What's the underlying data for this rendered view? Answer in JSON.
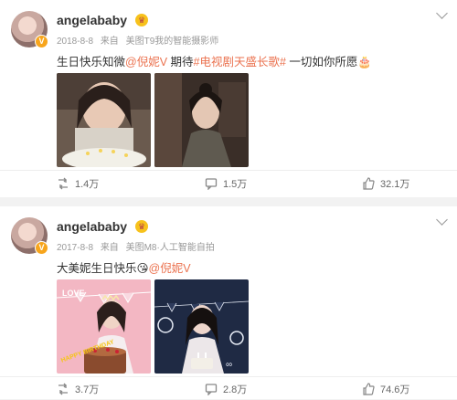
{
  "posts": [
    {
      "username": "angelababy",
      "date": "2018-8-8",
      "from_label": "来自",
      "source": "美图T9我的智能摄影师",
      "text_prefix": "生日快乐知微",
      "mention": "@倪妮V",
      "text_mid": " 期待",
      "topic": "#电视剧天盛长歌#",
      "text_suffix": " 一切如你所愿🎂",
      "repost_count": "1.4万",
      "comment_count": "1.5万",
      "like_count": "32.1万"
    },
    {
      "username": "angelababy",
      "date": "2017-8-8",
      "from_label": "来自",
      "source": "美图M8·人工智能自拍",
      "text_prefix": "大美妮生日快乐",
      "mention": "@倪妮V",
      "image_caption_1": "LOVE",
      "image_caption_2": "HAPPY BIRTHDAY",
      "repost_count": "3.7万",
      "comment_count": "2.8万",
      "like_count": "74.6万"
    }
  ]
}
